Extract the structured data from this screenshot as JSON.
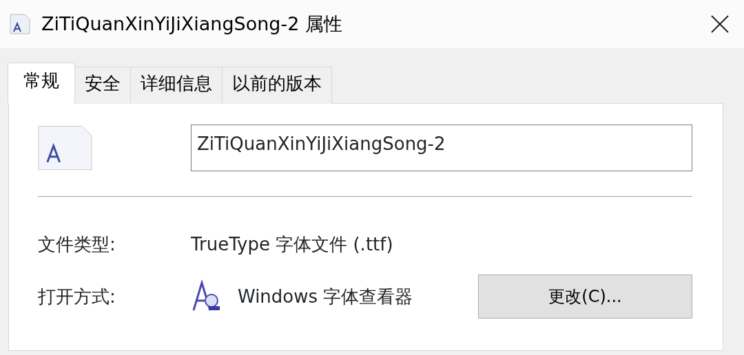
{
  "window": {
    "title": "ZiTiQuanXinYiJiXiangSong-2 属性"
  },
  "tabs": [
    {
      "label": "常规",
      "selected": true
    },
    {
      "label": "安全",
      "selected": false
    },
    {
      "label": "详细信息",
      "selected": false
    },
    {
      "label": "以前的版本",
      "selected": false
    }
  ],
  "file_name": {
    "value": "ZiTiQuanXinYiJiXiangSong-2"
  },
  "properties": [
    {
      "label": "文件类型:",
      "value": "TrueType 字体文件 (.ttf)",
      "kind": "text"
    },
    {
      "label": "打开方式:",
      "value": "Windows 字体查看器",
      "kind": "app",
      "button": "更改(C)..."
    }
  ]
}
